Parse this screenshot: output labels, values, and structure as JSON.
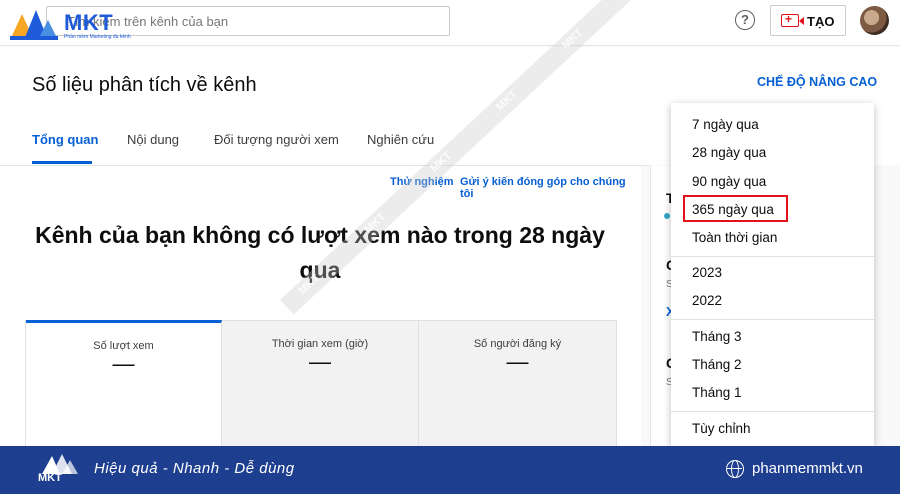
{
  "topbar": {
    "brand": "MKT",
    "brand_tagline": "Phần mềm Marketing đa kênh",
    "search_placeholder": "Tìm kiếm trên kênh của bạn",
    "create_label": "TẠO"
  },
  "header": {
    "title": "Số liệu phân tích về kênh",
    "advanced_mode": "CHẾ ĐỘ NÂNG CAO",
    "tabs": [
      "Tổng quan",
      "Nội dung",
      "Đối tượng người xem",
      "Nghiên cứu"
    ]
  },
  "card": {
    "beta": "Thử nghiệm",
    "feedback": "Gửi ý kiến đóng góp cho chúng tôi",
    "headline": "Kênh của bạn không có lượt xem nào trong 28 ngày qua",
    "metrics": [
      {
        "label": "Số lượt xem",
        "value": "—"
      },
      {
        "label": "Thời gian xem (giờ)",
        "value": "—"
      },
      {
        "label": "Số người đăng ký",
        "value": "—"
      }
    ]
  },
  "right_peek": [
    "T",
    "C",
    "S",
    "X",
    "C",
    "S"
  ],
  "dropdown": {
    "items": [
      "7 ngày qua",
      "28 ngày qua",
      "90 ngày qua",
      "365 ngày qua",
      "Toàn thời gian",
      "2023",
      "2022",
      "Tháng 3",
      "Tháng 2",
      "Tháng 1",
      "Tùy chỉnh"
    ],
    "highlighted": "365 ngày qua"
  },
  "watermark": "MKT",
  "footer": {
    "brand": "MKT",
    "slogan": "Hiệu quả - Nhanh - Dễ dùng",
    "website": "phanmemmkt.vn"
  },
  "colors": {
    "accent": "#065fd4",
    "highlight_box": "#e0131b",
    "footer_bg": "#1e3f8f"
  }
}
